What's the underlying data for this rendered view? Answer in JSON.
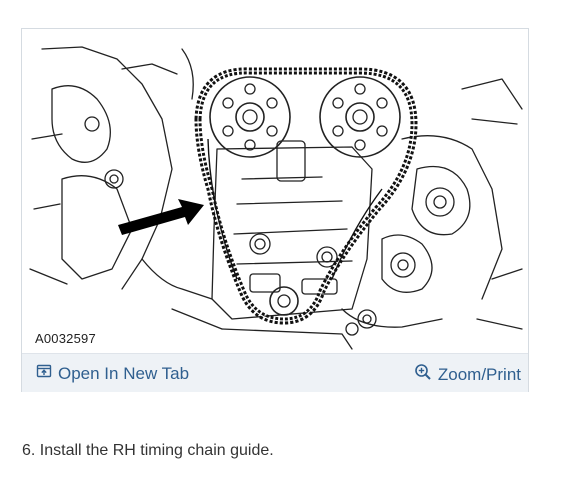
{
  "figure": {
    "caption": "A0032597",
    "alt": "Timing chain assembly diagram with arrow pointing to RH chain guide"
  },
  "toolbar": {
    "open_tab_label": "Open In New Tab",
    "open_tab_icon": "open-in-new-tab-icon",
    "zoom_label": "Zoom/Print",
    "zoom_icon": "magnifier-plus-icon",
    "link_color": "#2f5f8f",
    "background_color": "#eef2f6"
  },
  "step": {
    "text": "6. Install the RH timing chain guide."
  }
}
